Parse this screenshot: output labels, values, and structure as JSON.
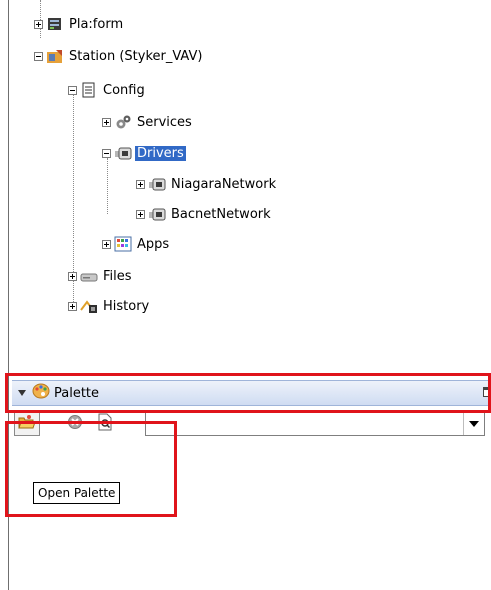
{
  "tree": {
    "platform": {
      "label": "Pla:form",
      "icon": "platform-icon"
    },
    "station": {
      "label": "Station (Styker_VAV)",
      "icon": "station-icon"
    },
    "config": {
      "label": "Config",
      "icon": "config-icon"
    },
    "services": {
      "label": "Services",
      "icon": "services-icon"
    },
    "drivers": {
      "label": "Drivers",
      "icon": "drivers-icon",
      "selected": true
    },
    "niagara_network": {
      "label": "NiagaraNetwork",
      "icon": "network-icon"
    },
    "bacnet_network": {
      "label": "BacnetNetwork",
      "icon": "network-icon"
    },
    "apps": {
      "label": "Apps",
      "icon": "apps-icon"
    },
    "files": {
      "label": "Files",
      "icon": "files-icon"
    },
    "history": {
      "label": "History",
      "icon": "history-icon"
    }
  },
  "palette": {
    "title": "Palette",
    "combo_value": "",
    "tooltip": "Open Palette"
  },
  "colors": {
    "selection": "#3169c6",
    "highlight": "#e0141b",
    "header": "#cfdcf2"
  }
}
